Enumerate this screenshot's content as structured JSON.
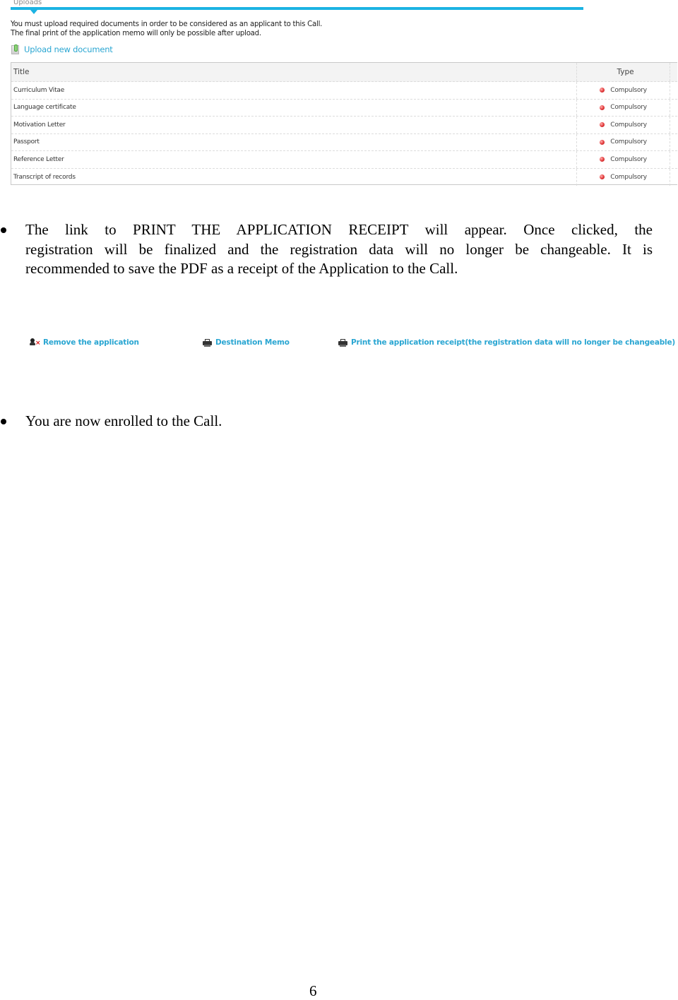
{
  "uploads": {
    "tab_label": "Uploads",
    "accent_color": "#1bb3e3",
    "notice_lines": [
      "You must upload required documents in order to be considered as an applicant to this Call.",
      "The final print of the application memo will only be possible after upload."
    ],
    "upload_link": {
      "icon": "attachment-icon",
      "label": "Upload new document"
    },
    "table": {
      "columns": [
        "Title",
        "Type",
        ""
      ],
      "rows": [
        {
          "title": "Curriculum Vitae",
          "type": "Compulsory",
          "status_icon": "red-dot-icon"
        },
        {
          "title": "Language certificate",
          "type": "Compulsory",
          "status_icon": "red-dot-icon"
        },
        {
          "title": "Motivation Letter",
          "type": "Compulsory",
          "status_icon": "red-dot-icon"
        },
        {
          "title": "Passport",
          "type": "Compulsory",
          "status_icon": "red-dot-icon"
        },
        {
          "title": "Reference Letter",
          "type": "Compulsory",
          "status_icon": "red-dot-icon"
        },
        {
          "title": "Transcript of records",
          "type": "Compulsory",
          "status_icon": "red-dot-icon"
        }
      ]
    }
  },
  "paragraph1": {
    "lines": [
      "The link to PRINT THE APPLICATION RECEIPT will appear. Once clicked, the",
      "registration will be finalized and the registration data will no longer be changeable. It is",
      "recommended to save the PDF as a receipt of the Application to the Call."
    ]
  },
  "actions": {
    "link_color": "#2aa6d2",
    "remove": {
      "icon": "remove-user-icon",
      "label": "Remove the application"
    },
    "memo": {
      "icon": "printer-icon",
      "label": "Destination Memo"
    },
    "print": {
      "icon": "printer-icon",
      "label": "Print the application receipt(the registration data will no longer be changeable)"
    }
  },
  "paragraph2": {
    "text": "You are now enrolled to the Call."
  },
  "page_number": "6"
}
